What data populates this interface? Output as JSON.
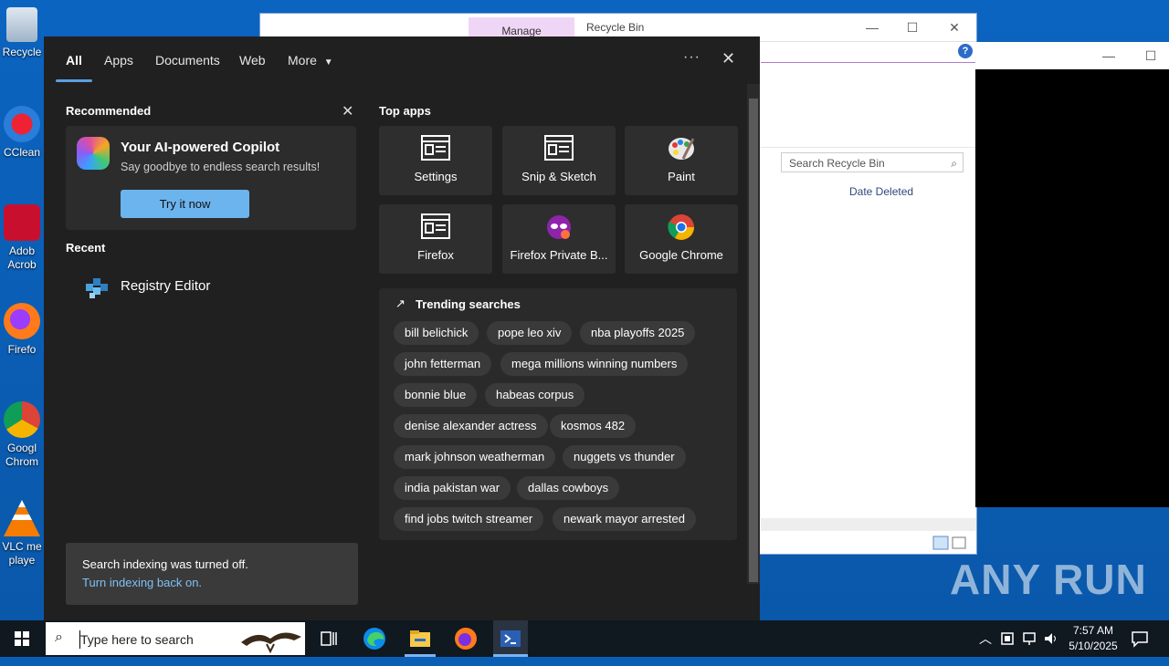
{
  "desktop": {
    "icons": [
      {
        "label": "Recycle",
        "icon": "recycle-bin-icon"
      },
      {
        "label": "CClean",
        "icon": "ccleaner-icon"
      },
      {
        "label": "Adob Acrob",
        "icon": "acrobat-icon"
      },
      {
        "label": "Firefo",
        "icon": "firefox-icon"
      },
      {
        "label": "Googl Chrom",
        "icon": "chrome-icon"
      },
      {
        "label": "VLC me playe",
        "icon": "vlc-icon"
      }
    ],
    "watermark": "ANY RUN"
  },
  "explorer": {
    "manage_tab": "Manage",
    "title": "Recycle Bin",
    "search_placeholder": "Search Recycle Bin",
    "column_date_deleted": "Date Deleted"
  },
  "search_panel": {
    "tabs": [
      {
        "label": "All",
        "active": true
      },
      {
        "label": "Apps"
      },
      {
        "label": "Documents"
      },
      {
        "label": "Web"
      },
      {
        "label": "More"
      }
    ],
    "more_ellipsis": "···",
    "recommended": {
      "heading": "Recommended",
      "card_title": "Your AI-powered Copilot",
      "card_subtitle": "Say goodbye to endless search results!",
      "button": "Try it now"
    },
    "recent": {
      "heading": "Recent",
      "items": [
        {
          "label": "Registry Editor",
          "icon": "registry-editor-icon"
        }
      ]
    },
    "index_notice": {
      "line1": "Search indexing was turned off.",
      "link": "Turn indexing back on."
    },
    "top_apps": {
      "heading": "Top apps",
      "apps": [
        {
          "label": "Settings",
          "icon": "settings-app-icon"
        },
        {
          "label": "Snip & Sketch",
          "icon": "snip-sketch-icon"
        },
        {
          "label": "Paint",
          "icon": "paint-icon"
        },
        {
          "label": "Firefox",
          "icon": "firefox-app-icon"
        },
        {
          "label": "Firefox Private B...",
          "icon": "firefox-private-icon"
        },
        {
          "label": "Google Chrome",
          "icon": "chrome-app-icon"
        }
      ]
    },
    "trending": {
      "heading": "Trending searches",
      "rows": [
        [
          "bill belichick",
          "pope leo xiv",
          "nba playoffs 2025"
        ],
        [
          "john fetterman",
          "mega millions winning numbers"
        ],
        [
          "bonnie blue",
          "habeas corpus"
        ],
        [
          "denise alexander actress",
          "kosmos 482"
        ],
        [
          "mark johnson weatherman",
          "nuggets vs thunder"
        ],
        [
          "india pakistan war",
          "dallas cowboys"
        ],
        [
          "find jobs twitch streamer",
          "newark mayor arrested"
        ]
      ]
    }
  },
  "taskbar": {
    "search_placeholder": "Type here to search",
    "time": "7:57 AM",
    "date": "5/10/2025"
  }
}
